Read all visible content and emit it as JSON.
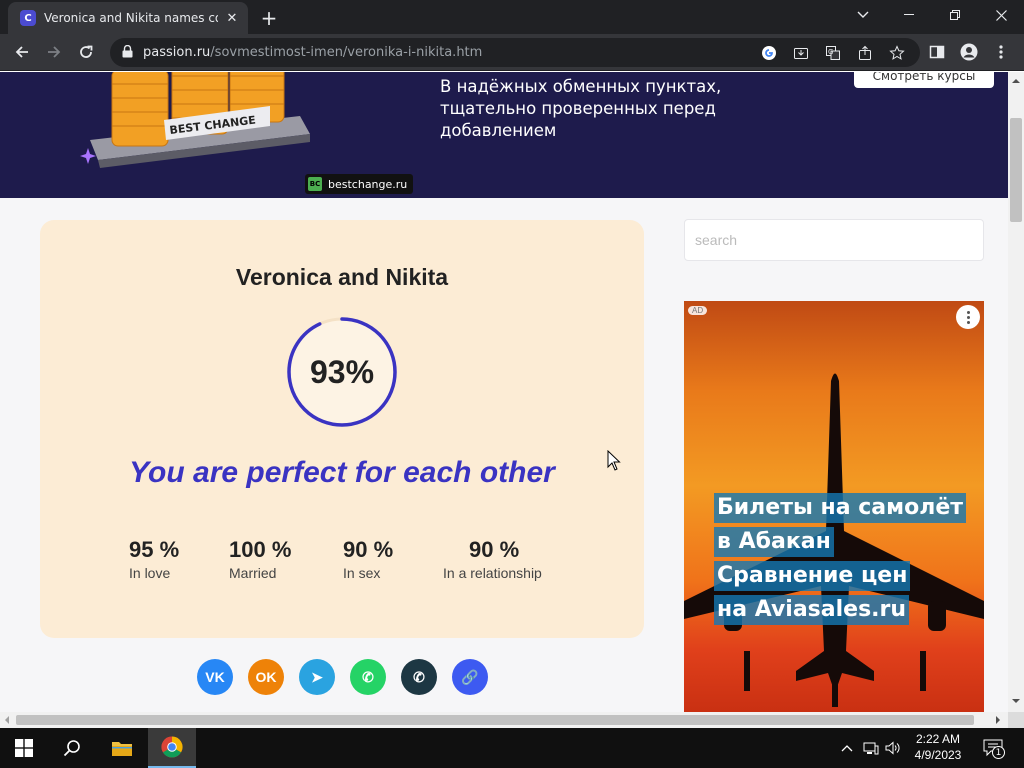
{
  "browser": {
    "tab_title": "Veronica and Nikita names comp",
    "favicon_letter": "C",
    "url_host": "passion.ru",
    "url_path": "/sovmestimost-imen/veronika-i-nikita.htm"
  },
  "banner": {
    "text_lines": [
      "В надёжных обменных пунктах,",
      "тщательно проверенных перед",
      "добавлением"
    ],
    "button_label": "Смотреть курсы",
    "brand_logo": "BC",
    "brand": "bestchange.ru",
    "art_label": "BEST CHANGE"
  },
  "result": {
    "names": "Veronica and Nikita",
    "score": "93%",
    "score_value": 93,
    "verdict": "You are perfect for each other",
    "stats": [
      {
        "value": "95 %",
        "label": "In love"
      },
      {
        "value": "100 %",
        "label": "Married"
      },
      {
        "value": "90 %",
        "label": "In sex"
      },
      {
        "value": "90 %",
        "label": "In a relationship"
      }
    ],
    "accent_color": "#3a33c2"
  },
  "share": [
    {
      "name": "vk",
      "glyph": "VK",
      "color": "#2787f5"
    },
    {
      "name": "odnoklassniki",
      "glyph": "OK",
      "color": "#ee8208"
    },
    {
      "name": "telegram",
      "glyph": "➤",
      "color": "#2aa3e0"
    },
    {
      "name": "whatsapp",
      "glyph": "✆",
      "color": "#25d366"
    },
    {
      "name": "viber",
      "glyph": "✆",
      "color": "#1d3743"
    },
    {
      "name": "copy-link",
      "glyph": "🔗",
      "color": "#3d5af1"
    }
  ],
  "sidebar": {
    "search_placeholder": "search"
  },
  "ad": {
    "tag": "AD",
    "lines": [
      "Билеты на самолёт",
      "в Абакан",
      "Сравнение цен",
      "на Aviasales.ru"
    ]
  },
  "taskbar": {
    "time": "2:22 AM",
    "date": "4/9/2023",
    "notification_count": "1"
  }
}
